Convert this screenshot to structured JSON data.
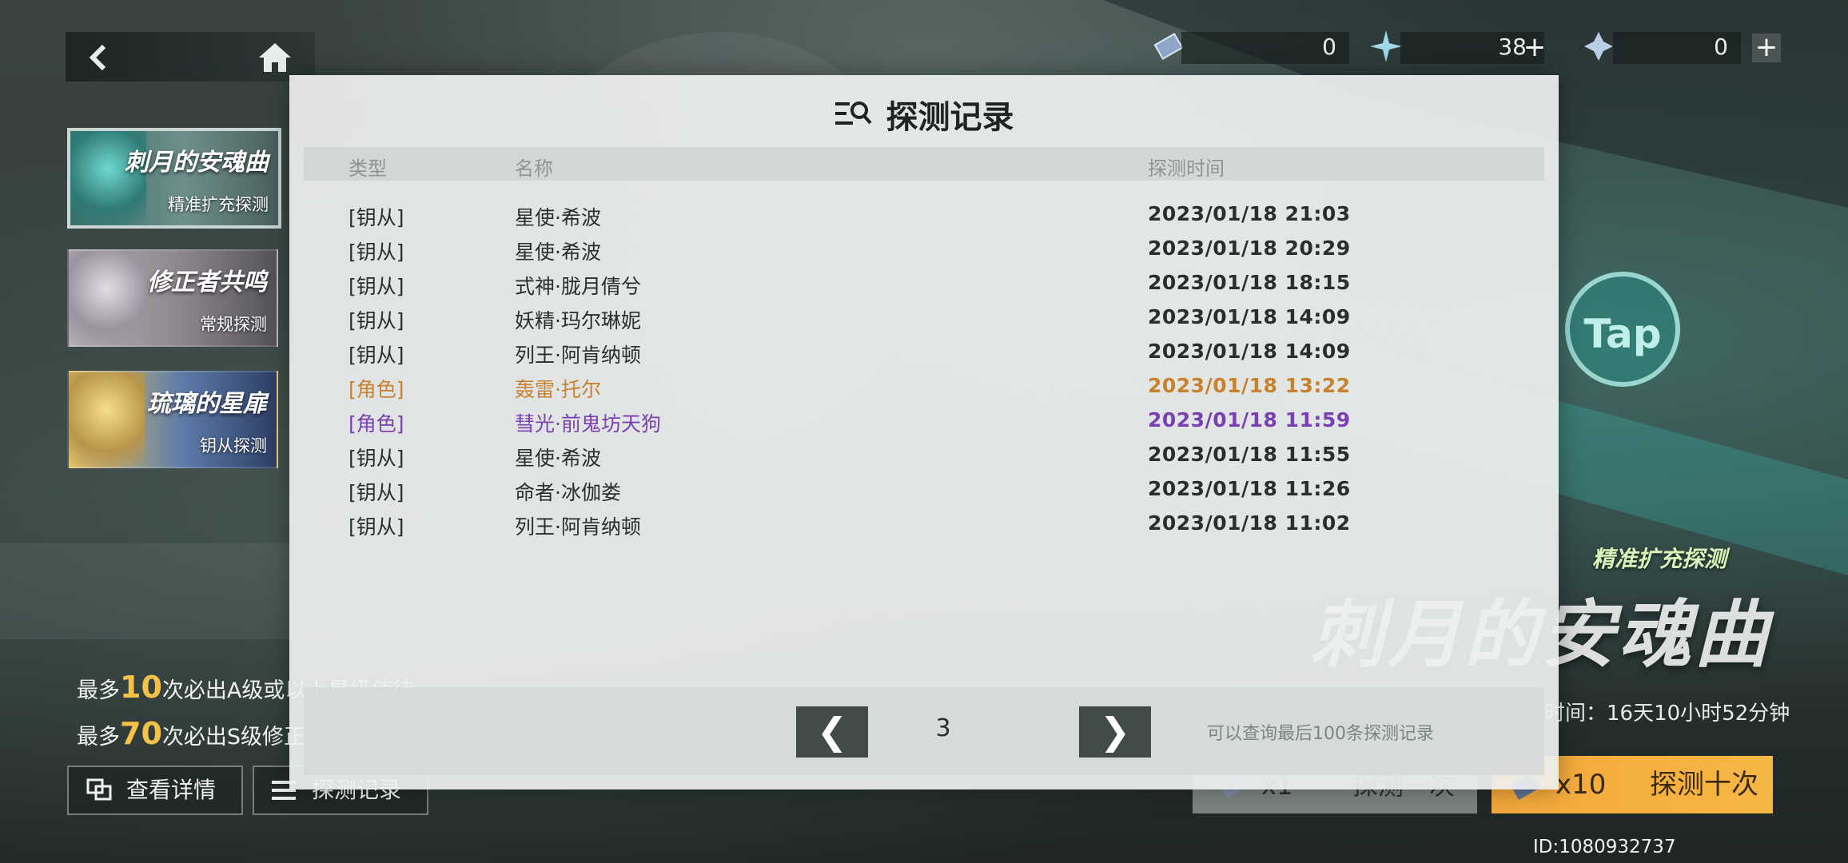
{
  "nav": {
    "back_label": "‹"
  },
  "currencies": [
    {
      "icon": "ticket-icon",
      "value": "0"
    },
    {
      "icon": "star-crystal-icon",
      "value": "38"
    },
    {
      "icon": "key-icon",
      "value": "0"
    }
  ],
  "banners": [
    {
      "title": "刺月的安魂曲",
      "sub": "精准扩充探测",
      "selected": true
    },
    {
      "title": "修正者共鸣",
      "sub": "常规探测",
      "selected": false
    },
    {
      "title": "琉璃的星扉",
      "sub": "钥从探测",
      "selected": false
    }
  ],
  "guarantee": [
    {
      "pre": "最多",
      "num": "10",
      "post": "次必出A级或以上星级使徒"
    },
    {
      "pre": "最多",
      "num": "70",
      "post": "次必出S级修正者"
    }
  ],
  "buttons": {
    "details": "查看详情",
    "records": "探测记录"
  },
  "right": {
    "tap": "Tap",
    "banner_sub": "精准扩充探测",
    "banner_title": "刺月的安魂曲",
    "timer": "剩余时间：16天10小时52分钟",
    "draw_one_count": "x1",
    "draw_one_label": "探测一次",
    "draw_ten_count": "x10",
    "draw_ten_label": "探测十次",
    "uid": "ID:1080932737"
  },
  "modal": {
    "title": "探测记录",
    "headers": {
      "type": "类型",
      "name": "名称",
      "time": "探测时间"
    },
    "rows": [
      {
        "type": "[钥从]",
        "name": "星使·希波",
        "time": "2023/01/18 21:03",
        "color": "#2a2f2e"
      },
      {
        "type": "[钥从]",
        "name": "星使·希波",
        "time": "2023/01/18 20:29",
        "color": "#2a2f2e"
      },
      {
        "type": "[钥从]",
        "name": "式神·胧月倩兮",
        "time": "2023/01/18 18:15",
        "color": "#2a2f2e"
      },
      {
        "type": "[钥从]",
        "name": "妖精·玛尔琳妮",
        "time": "2023/01/18 14:09",
        "color": "#2a2f2e"
      },
      {
        "type": "[钥从]",
        "name": "列王·阿肯纳顿",
        "time": "2023/01/18 14:09",
        "color": "#2a2f2e"
      },
      {
        "type": "[角色]",
        "name": "轰雷·托尔",
        "time": "2023/01/18 13:22",
        "color": "#c8822e"
      },
      {
        "type": "[角色]",
        "name": "彗光·前鬼坊天狗",
        "time": "2023/01/18 11:59",
        "color": "#7a3fb0"
      },
      {
        "type": "[钥从]",
        "name": "星使·希波",
        "time": "2023/01/18 11:55",
        "color": "#2a2f2e"
      },
      {
        "type": "[钥从]",
        "name": "命者·冰伽娄",
        "time": "2023/01/18 11:26",
        "color": "#2a2f2e"
      },
      {
        "type": "[钥从]",
        "name": "列王·阿肯纳顿",
        "time": "2023/01/18 11:02",
        "color": "#2a2f2e"
      }
    ],
    "pager": {
      "prev": "❮",
      "next": "❯",
      "page": "3",
      "note": "可以查询最后100条探测记录"
    }
  }
}
